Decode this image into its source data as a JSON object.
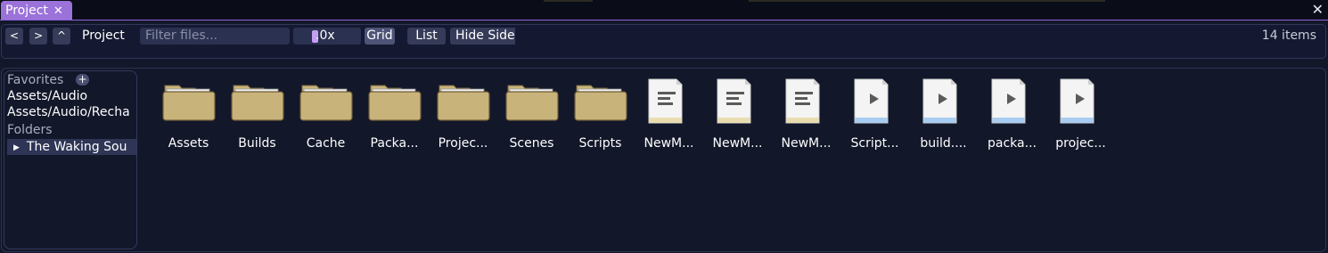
{
  "tab": {
    "label": "Project",
    "close_glyph": "✕"
  },
  "window_close_glyph": "✕",
  "toolbar": {
    "back": "<",
    "forward": ">",
    "up": "^",
    "breadcrumb": "Project",
    "filter_placeholder": "Filter files...",
    "zoom_value": ".0x",
    "grid_label": "Grid",
    "list_label": "List",
    "hide_side_label": "Hide Side",
    "count": "14 items"
  },
  "sidebar": {
    "favorites_heading": "Favorites",
    "favorites_add": "+",
    "favorites": [
      "Assets/Audio",
      "Assets/Audio/Recha"
    ],
    "folders_heading": "Folders",
    "root_folder": "The Waking Sou"
  },
  "items": [
    {
      "name": "Assets",
      "kind": "folder"
    },
    {
      "name": "Builds",
      "kind": "folder"
    },
    {
      "name": "Cache",
      "kind": "folder"
    },
    {
      "name": "Packa...",
      "kind": "folder"
    },
    {
      "name": "Projec...",
      "kind": "folder"
    },
    {
      "name": "Scenes",
      "kind": "folder"
    },
    {
      "name": "Scripts",
      "kind": "folder"
    },
    {
      "name": "NewM...",
      "kind": "text-file"
    },
    {
      "name": "NewM...",
      "kind": "text-file"
    },
    {
      "name": "NewM...",
      "kind": "text-file"
    },
    {
      "name": "Script...",
      "kind": "script-file"
    },
    {
      "name": "build....",
      "kind": "script-file"
    },
    {
      "name": "packa...",
      "kind": "script-file"
    },
    {
      "name": "projec...",
      "kind": "script-file"
    }
  ],
  "colors": {
    "accent": "#9a72d9",
    "folder": "#c8b47a",
    "text_file_band": "#e9ddb0",
    "script_file_band": "#a9cdf0"
  }
}
